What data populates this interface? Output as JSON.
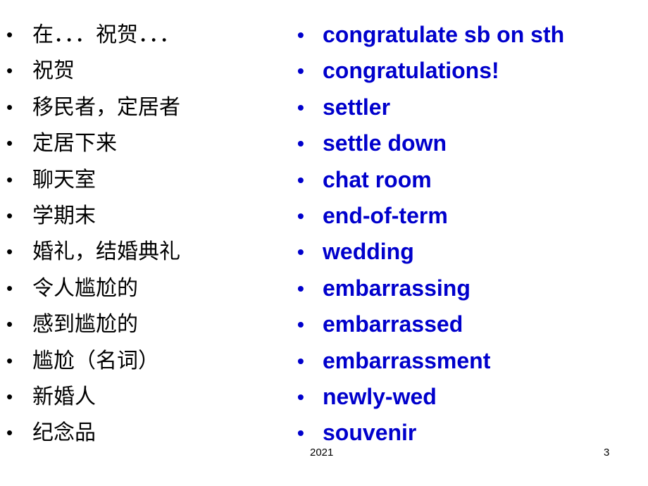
{
  "slide": {
    "left_items": [
      "在．．．祝贺．．．",
      "祝贺",
      "移民者，定居者",
      "定居下来",
      "聊天室",
      "学期末",
      "婚礼，结婚典礼",
      "令人尴尬的",
      "感到尴尬的",
      "尴尬（名词）",
      "新婚人",
      "纪念品"
    ],
    "right_items": [
      "congratulate sb on sth",
      "congratulations!",
      "settler",
      "settle down",
      "chat room",
      "end-of-term",
      "wedding",
      "embarrassing",
      "embarrassed",
      "embarrassment",
      "newly-wed",
      "souvenir"
    ],
    "bullet_glyph": "•",
    "colors": {
      "english_text": "#0000CC",
      "chinese_text": "#000000"
    }
  },
  "footer": {
    "year": "2021",
    "page_number": "3"
  }
}
